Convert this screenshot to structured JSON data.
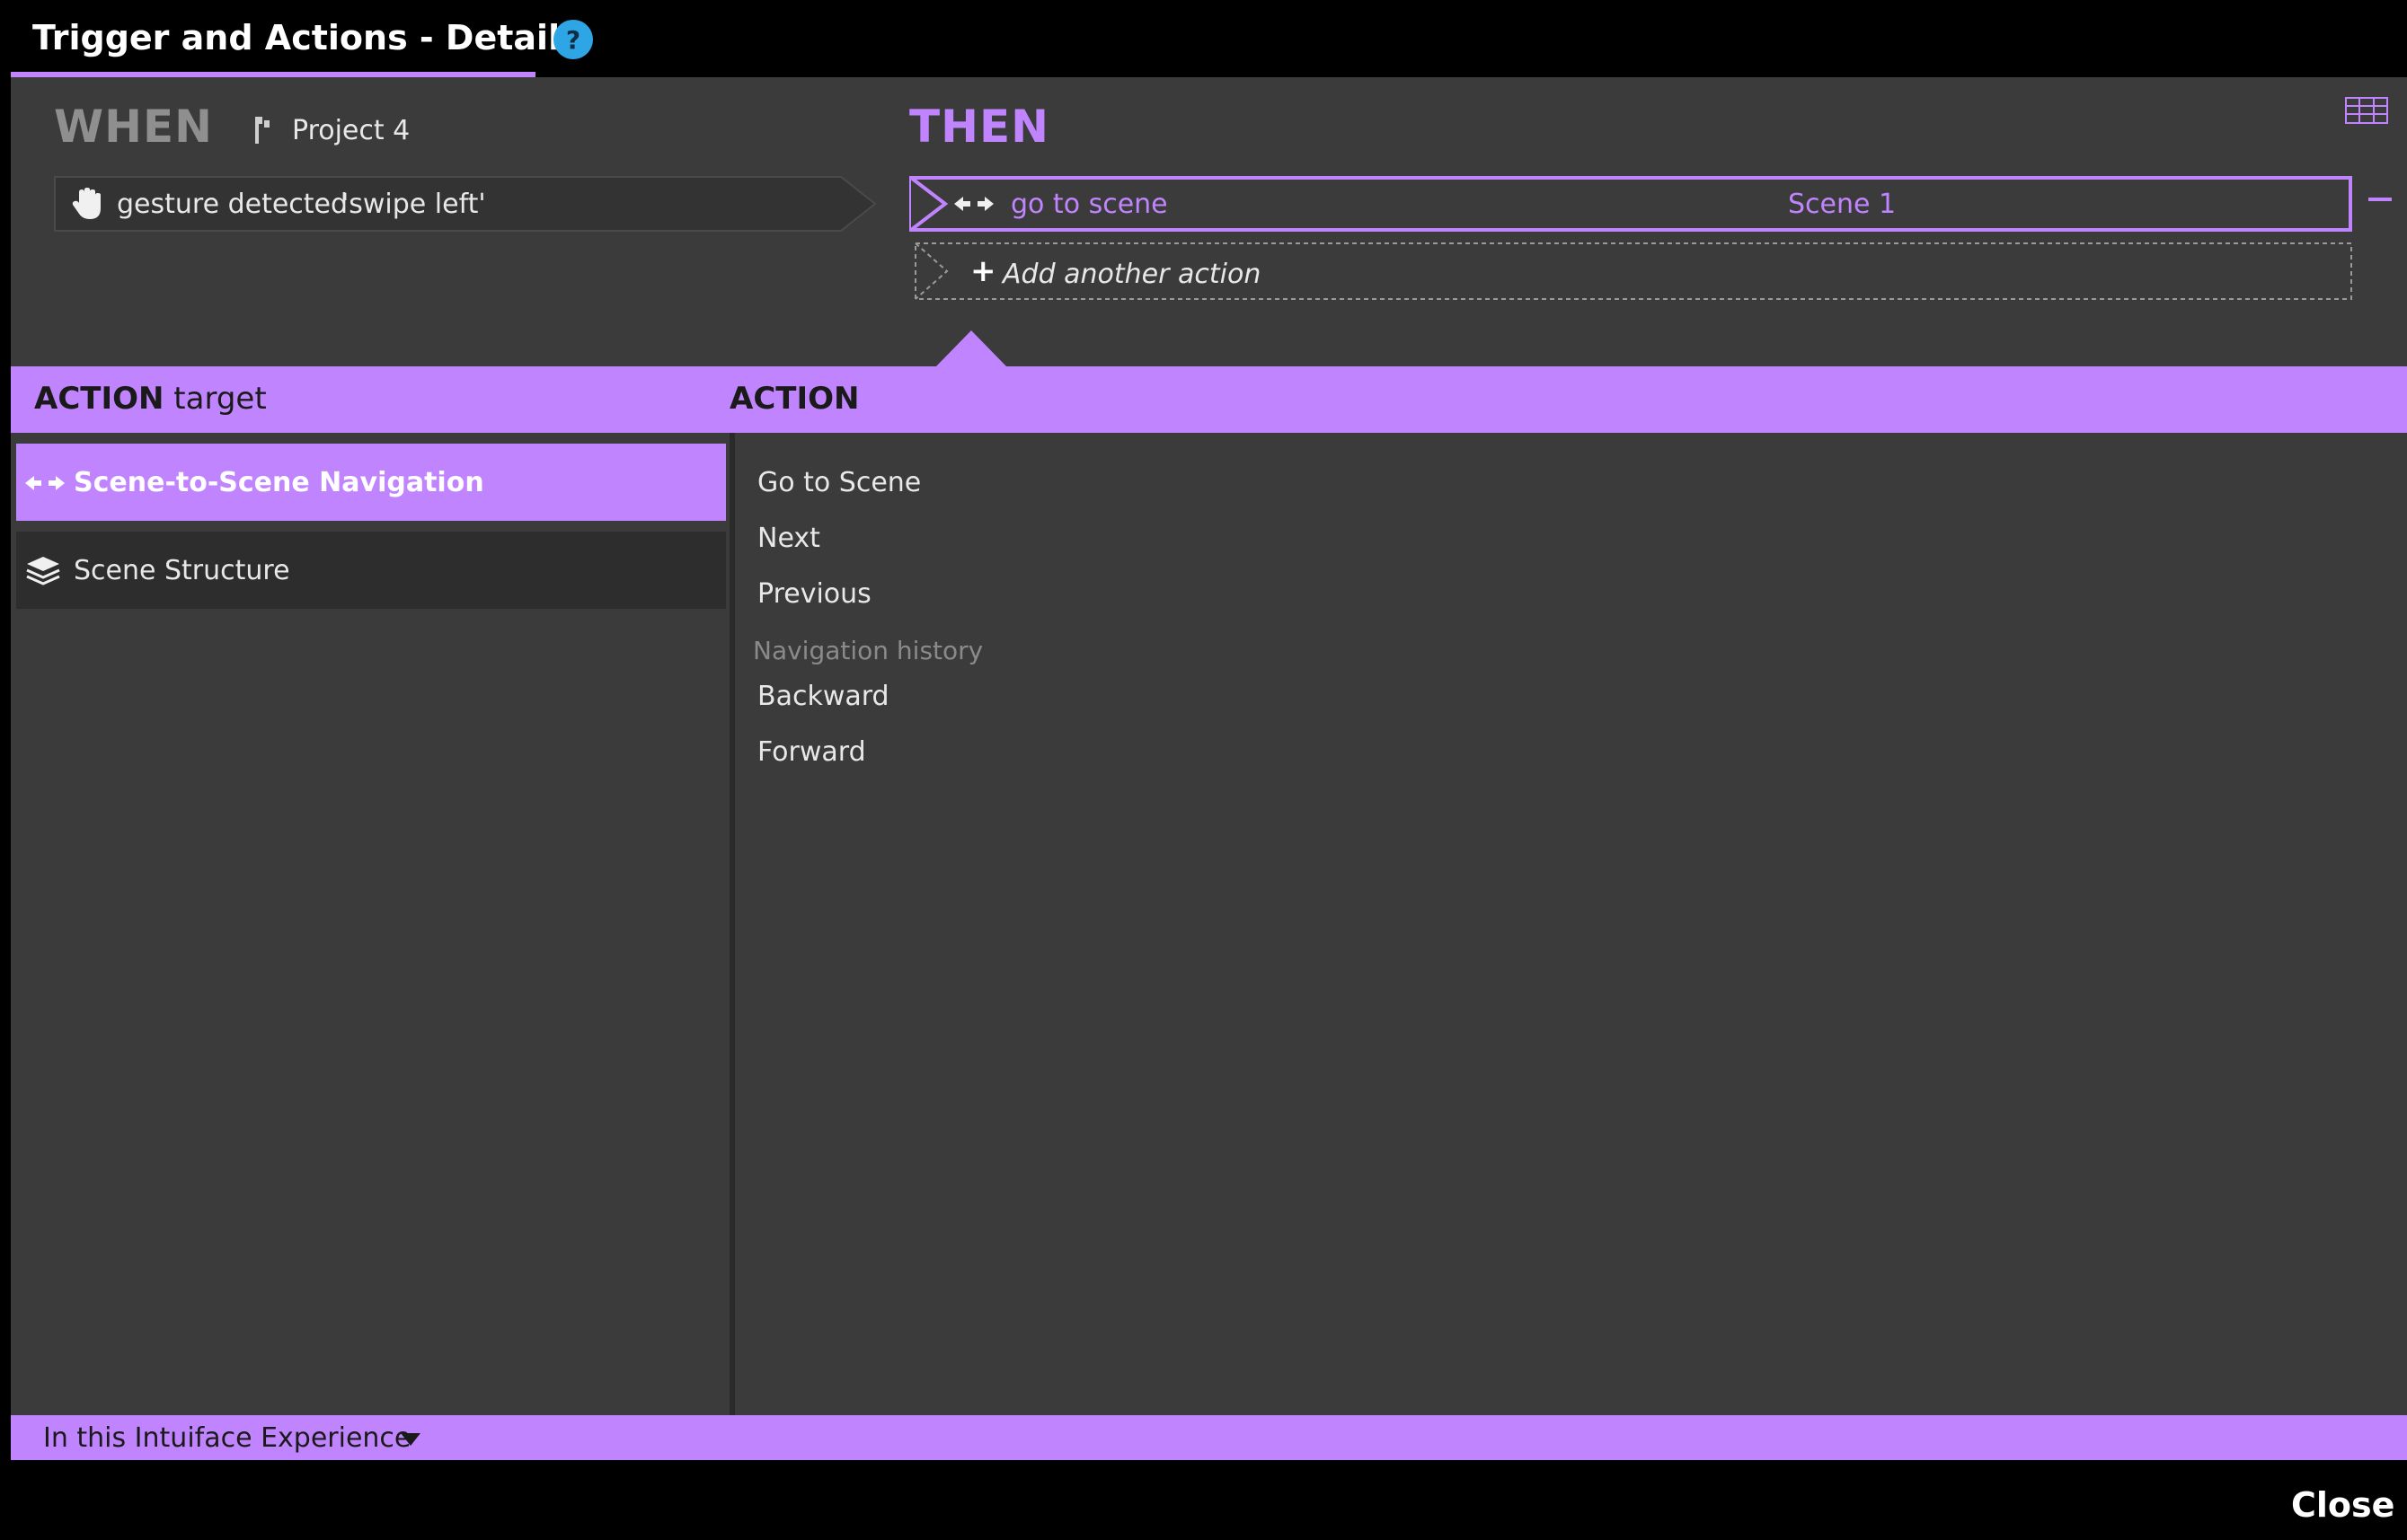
{
  "window": {
    "title": "Trigger and Actions - Details",
    "help_glyph": "?"
  },
  "when": {
    "label": "WHEN",
    "project_icon": "project-icon",
    "project_name": "Project 4",
    "trigger": {
      "icon": "hand-icon",
      "text": "gesture detected",
      "parameter": "'swipe left'"
    }
  },
  "then": {
    "label": "THEN",
    "action": {
      "icon": "arrows-icon",
      "name": "go to scene",
      "value": "Scene 1"
    },
    "add_another_glyph": "+",
    "add_another_label": "Add another action"
  },
  "header": {
    "target_strong": "ACTION",
    "target_rest": " target",
    "action_label": "ACTION"
  },
  "targets": [
    {
      "label": "Scene-to-Scene Navigation",
      "icon": "arrows-icon",
      "selected": true
    },
    {
      "label": "Scene Structure",
      "icon": "layers-icon",
      "selected": false
    }
  ],
  "actions": {
    "items": [
      "Go to Scene",
      "Next",
      "Previous"
    ],
    "section": "Navigation history",
    "history_items": [
      "Backward",
      "Forward"
    ]
  },
  "footer": {
    "scope": "In this Intuiface Experience",
    "close_label": "Close"
  },
  "colors": {
    "accent": "#c184ff",
    "panel": "#3b3b3b",
    "help": "#2ea6e6"
  }
}
